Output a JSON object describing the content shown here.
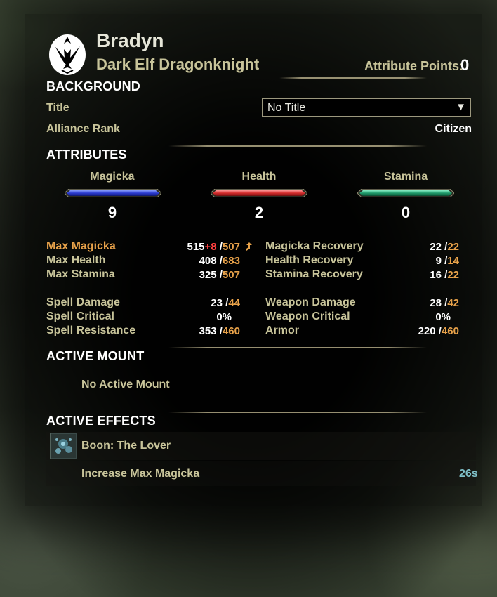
{
  "character": {
    "name": "Bradyn",
    "race_class": "Dark Elf Dragonknight",
    "attribute_points_label": "Attribute Points:",
    "attribute_points": "0"
  },
  "background": {
    "heading": "BACKGROUND",
    "title_label": "Title",
    "title_value": "No Title",
    "alliance_rank_label": "Alliance Rank",
    "alliance_rank_value": "Citizen"
  },
  "attributes": {
    "heading": "ATTRIBUTES",
    "items": [
      {
        "name": "Magicka",
        "value": "9",
        "color": "#3a52d8"
      },
      {
        "name": "Health",
        "value": "2",
        "color": "#d83a3a"
      },
      {
        "name": "Stamina",
        "value": "0",
        "color": "#2aa47a"
      }
    ]
  },
  "stats": {
    "left": [
      {
        "label": "Max Magicka",
        "current": "515",
        "bonus": "+8",
        "sep": "/",
        "max": "507",
        "highlight": true
      },
      {
        "label": "Max Health",
        "current": "408",
        "bonus": "",
        "sep": "/",
        "max": "683",
        "highlight": false
      },
      {
        "label": "Max Stamina",
        "current": "325",
        "bonus": "",
        "sep": "/",
        "max": "507",
        "highlight": false
      },
      {
        "label": "Spell Damage",
        "current": "23",
        "bonus": "",
        "sep": "/",
        "max": "44",
        "highlight": false
      },
      {
        "label": "Spell Critical",
        "current": "0%",
        "bonus": "",
        "sep": "",
        "max": "",
        "highlight": false
      },
      {
        "label": "Spell Resistance",
        "current": "353",
        "bonus": "",
        "sep": "/",
        "max": "460",
        "highlight": false
      }
    ],
    "right": [
      {
        "label": "Magicka Recovery",
        "current": "22",
        "sep": "/",
        "max": "22"
      },
      {
        "label": "Health Recovery",
        "current": "9",
        "sep": "/",
        "max": "14"
      },
      {
        "label": "Stamina Recovery",
        "current": "16",
        "sep": "/",
        "max": "22"
      },
      {
        "label": "Weapon Damage",
        "current": "28",
        "sep": "/",
        "max": "42"
      },
      {
        "label": "Weapon Critical",
        "current": "0%",
        "sep": "",
        "max": ""
      },
      {
        "label": "Armor",
        "current": "220",
        "sep": "/",
        "max": "460"
      }
    ]
  },
  "mount": {
    "heading": "ACTIVE MOUNT",
    "status": "No Active Mount"
  },
  "effects": {
    "heading": "ACTIVE EFFECTS",
    "boon_name": "Boon: The Lover",
    "effect_desc": "Increase Max Magicka",
    "timer": "26s"
  }
}
